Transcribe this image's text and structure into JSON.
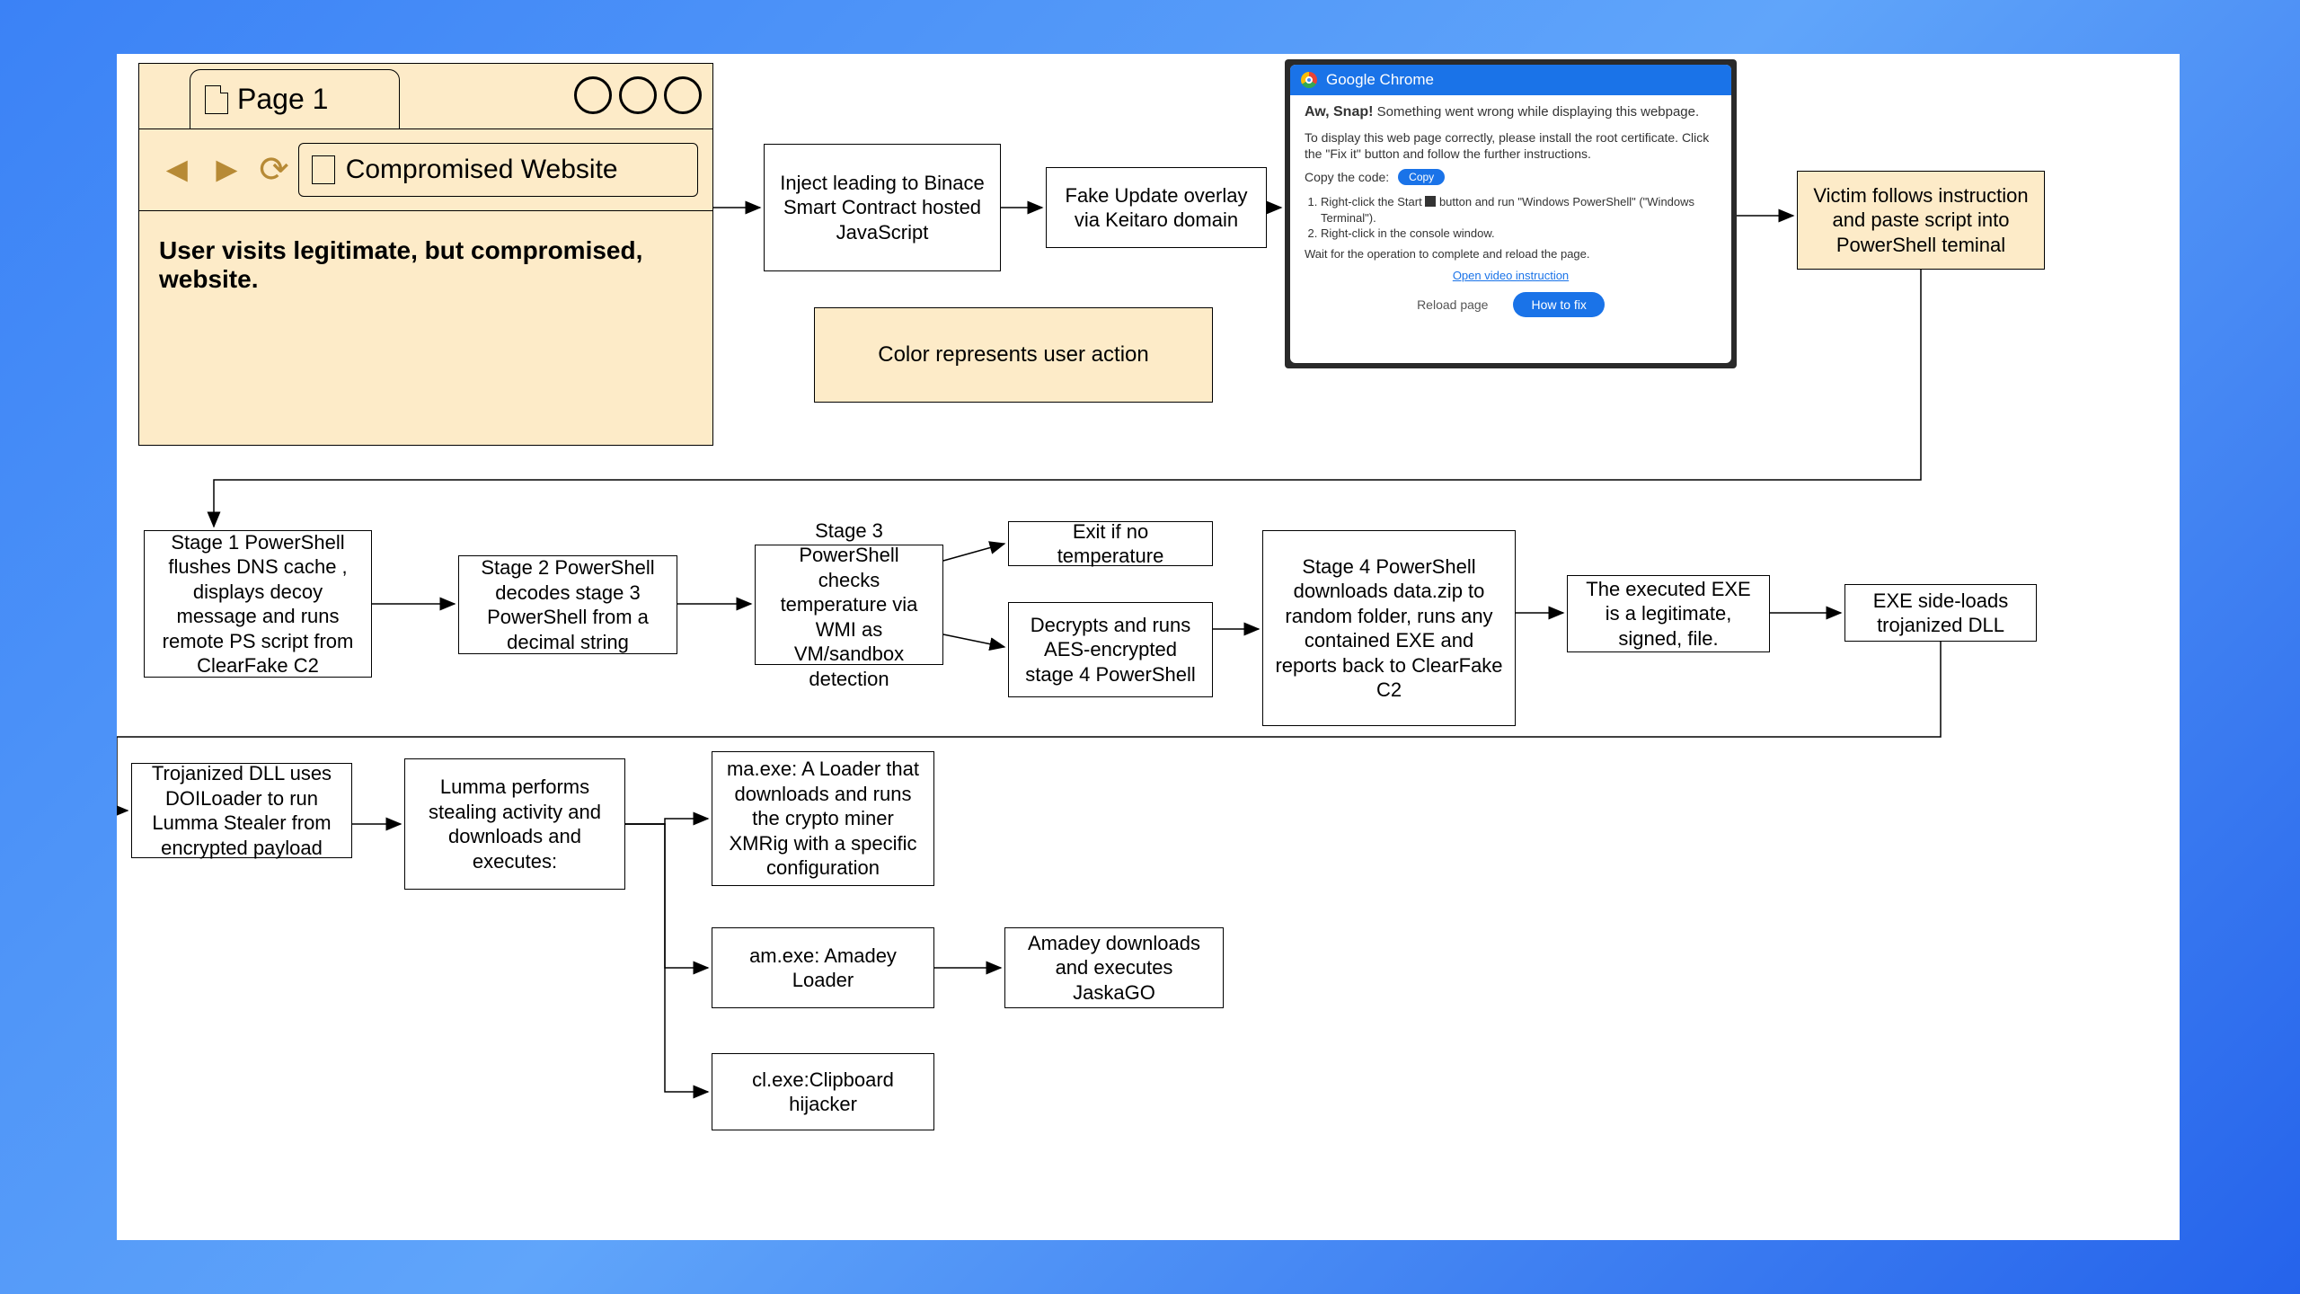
{
  "browser": {
    "tab_label": "Page 1",
    "url_text": "Compromised Website",
    "body_text": "User visits legitimate, but compromised, website."
  },
  "legend": {
    "text": "Color represents user action"
  },
  "boxes": {
    "inject": "Inject leading to Binace Smart Contract hosted JavaScript",
    "fake_update": "Fake Update overlay via Keitaro domain",
    "victim": "Victim follows instruction and paste script into PowerShell teminal",
    "stage1": "Stage 1 PowerShell flushes DNS cache , displays decoy message and runs remote PS script from ClearFake C2",
    "stage2": "Stage 2 PowerShell decodes stage 3 PowerShell from a decimal string",
    "stage3": "Stage 3 PowerShell checks temperature via WMI as VM/sandbox detection",
    "exit_temp": "Exit if no temperature",
    "decrypt": "Decrypts and runs AES-encrypted stage 4 PowerShell",
    "stage4": "Stage 4 PowerShell downloads data.zip to random folder, runs any contained EXE and reports back to ClearFake C2",
    "exe_legit": "The executed EXE is a legitimate, signed, file.",
    "sideload": "EXE side-loads trojanized DLL",
    "doiloader": "Trojanized DLL uses DOILoader to run Lumma Stealer from encrypted payload",
    "lumma": "Lumma performs stealing activity and downloads and executes:",
    "ma": "ma.exe: A Loader that downloads and runs the crypto miner XMRig with a specific configuration",
    "am": "am.exe: Amadey Loader",
    "cl": "cl.exe:Clipboard hijacker",
    "amadey": "Amadey downloads and executes JaskaGO"
  },
  "chrome": {
    "title": "Google Chrome",
    "aw_bold": "Aw, Snap!",
    "aw_rest": " Something went wrong while displaying this webpage.",
    "para1": "To display this web page correctly, please install the root certificate. Click the \"Fix it\" button and follow the further instructions.",
    "copy_label": "Copy the code:",
    "copy_btn": "Copy",
    "step1a": "Right-click the Start ",
    "step1b": " button and run \"Windows PowerShell\" (\"Windows Terminal\").",
    "step2": "Right-click in the console window.",
    "wait": "Wait for the operation to complete and reload the page.",
    "video_link": "Open video instruction",
    "reload": "Reload page",
    "fix": "How to fix"
  }
}
